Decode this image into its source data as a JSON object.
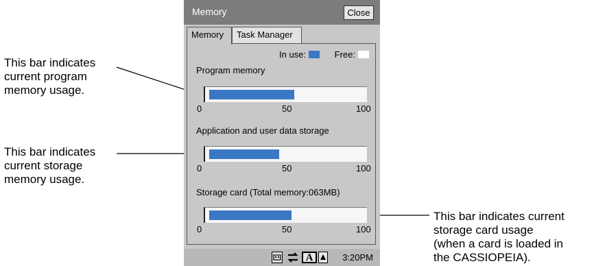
{
  "window": {
    "title": "Memory",
    "close_label": "Close"
  },
  "tabs": [
    {
      "label": "Memory",
      "active": true
    },
    {
      "label": "Task Manager",
      "active": false
    }
  ],
  "legend": {
    "in_use_label": "In use:",
    "in_use_color": "#3a78c4",
    "free_label": "Free:",
    "free_color": "#ffffff"
  },
  "sections": [
    {
      "label": "Program memory",
      "usage_percent": 55,
      "ticks": [
        "0",
        "50",
        "100"
      ]
    },
    {
      "label": "Application and user data storage",
      "usage_percent": 45,
      "ticks": [
        "0",
        "50",
        "100"
      ]
    },
    {
      "label": "Storage card (Total memory:063MB)",
      "usage_percent": 53,
      "ticks": [
        "0",
        "50",
        "100"
      ]
    }
  ],
  "taskbar": {
    "clock": "3:20PM",
    "icons": [
      "keyboard-icon",
      "connection-icon",
      "font-size-icon",
      "input-mode-icon"
    ]
  },
  "callouts": [
    {
      "lines": [
        "This bar indicates",
        "current program",
        "memory usage."
      ]
    },
    {
      "lines": [
        "This bar indicates",
        "current storage",
        "memory usage."
      ]
    },
    {
      "lines": [
        "This bar indicates current",
        "storage card usage",
        "(when a card is loaded in",
        "the CASSIOPEIA)."
      ]
    }
  ]
}
